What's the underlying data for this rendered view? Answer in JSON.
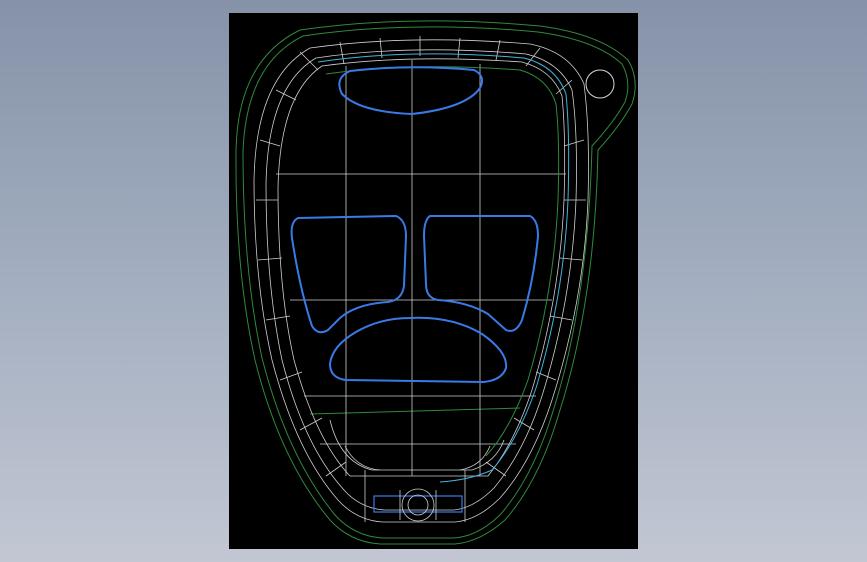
{
  "app": {
    "background_top": "#8592a8",
    "background_bottom": "#c2c7d3",
    "viewport_bg": "#000000"
  },
  "drawing": {
    "subject": "key-fob-housing-wireframe",
    "colors": {
      "outer_edge": "#2f8a3a",
      "mesh": "#d4d4d4",
      "button": "#3a7ae6",
      "inner_cyan": "#3fb3e0"
    },
    "buttons": [
      "top-button",
      "left-button",
      "right-button",
      "bottom-button"
    ]
  }
}
